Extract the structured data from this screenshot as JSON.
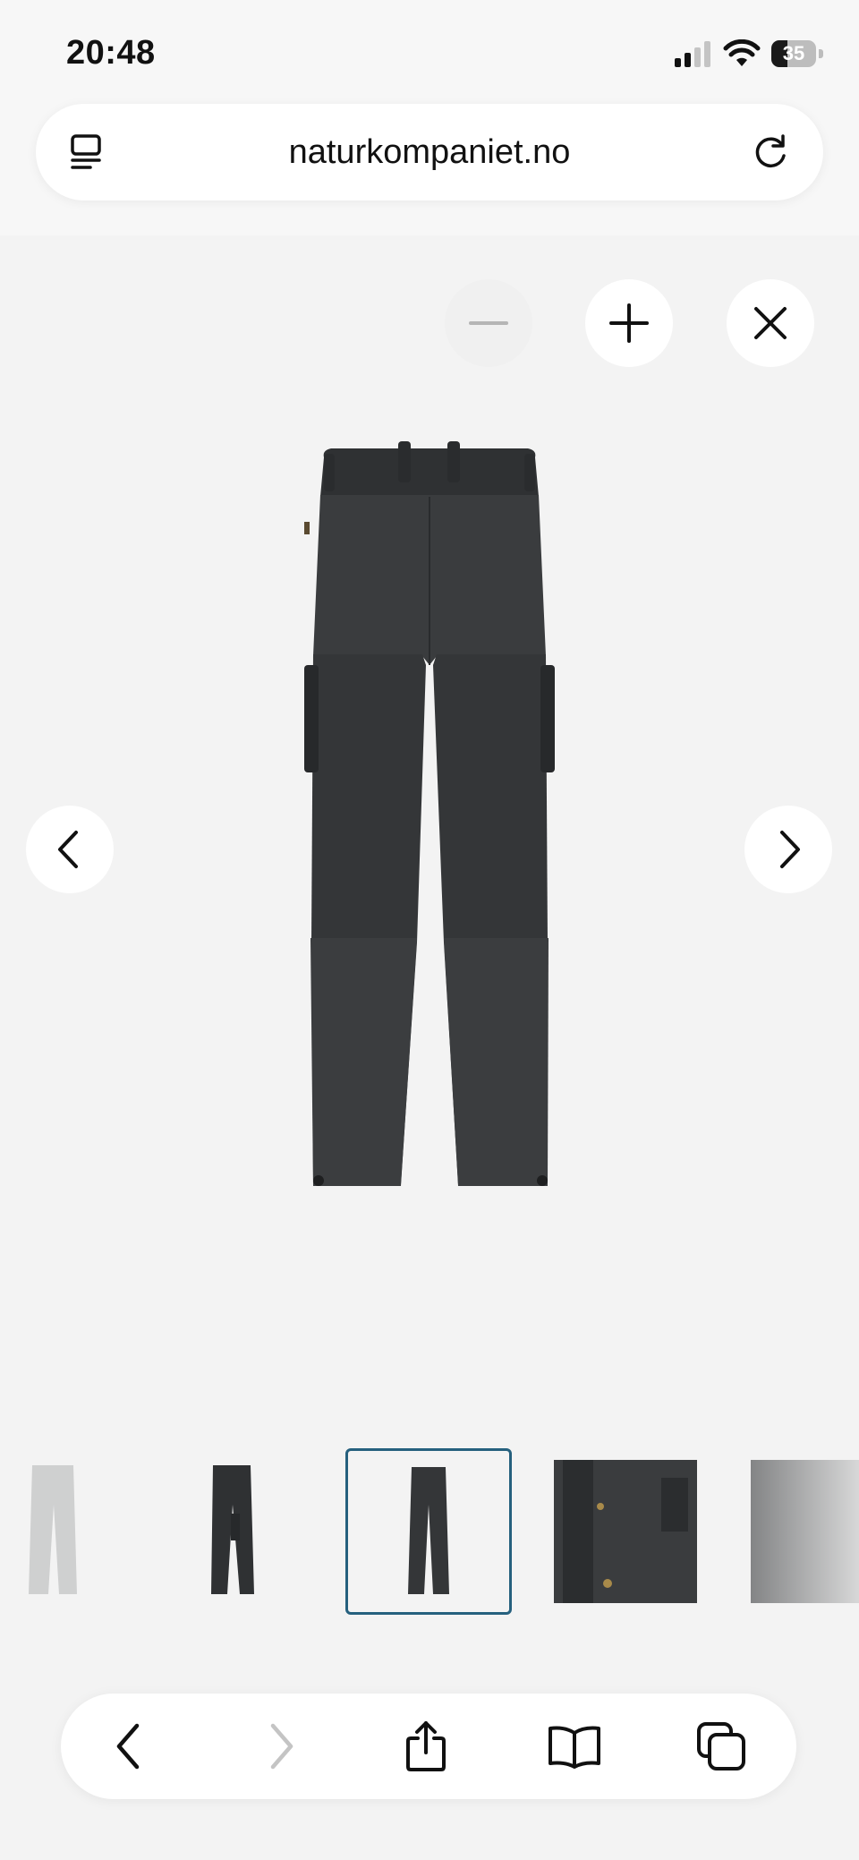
{
  "status_bar": {
    "time": "20:48",
    "battery_text": "35",
    "battery_level": 0.35
  },
  "browser": {
    "url": "naturkompaniet.no",
    "left_icon": "tab-overview-icon",
    "right_icon": "reload-icon"
  },
  "viewer": {
    "zoom_out_icon": "minus-icon",
    "zoom_in_icon": "plus-icon",
    "close_icon": "close-icon",
    "prev_icon": "chevron-left-icon",
    "next_icon": "chevron-right-icon",
    "product_color": "#343638",
    "selected_thumbnail_index": 2
  },
  "thumbnails": [
    {
      "name": "thumbnail-pants-front-faded"
    },
    {
      "name": "thumbnail-pants-side"
    },
    {
      "name": "thumbnail-pants-back"
    },
    {
      "name": "thumbnail-pocket-closeup"
    },
    {
      "name": "thumbnail-detail-faded"
    }
  ],
  "toolbar": {
    "back_icon": "back-icon",
    "forward_icon": "forward-icon",
    "share_icon": "share-icon",
    "bookmarks_icon": "bookmarks-icon",
    "tabs_icon": "tabs-icon"
  },
  "colors": {
    "selected_border": "#25607e",
    "viewer_background": "#f3f3f3",
    "pants_dark": "#343638"
  }
}
